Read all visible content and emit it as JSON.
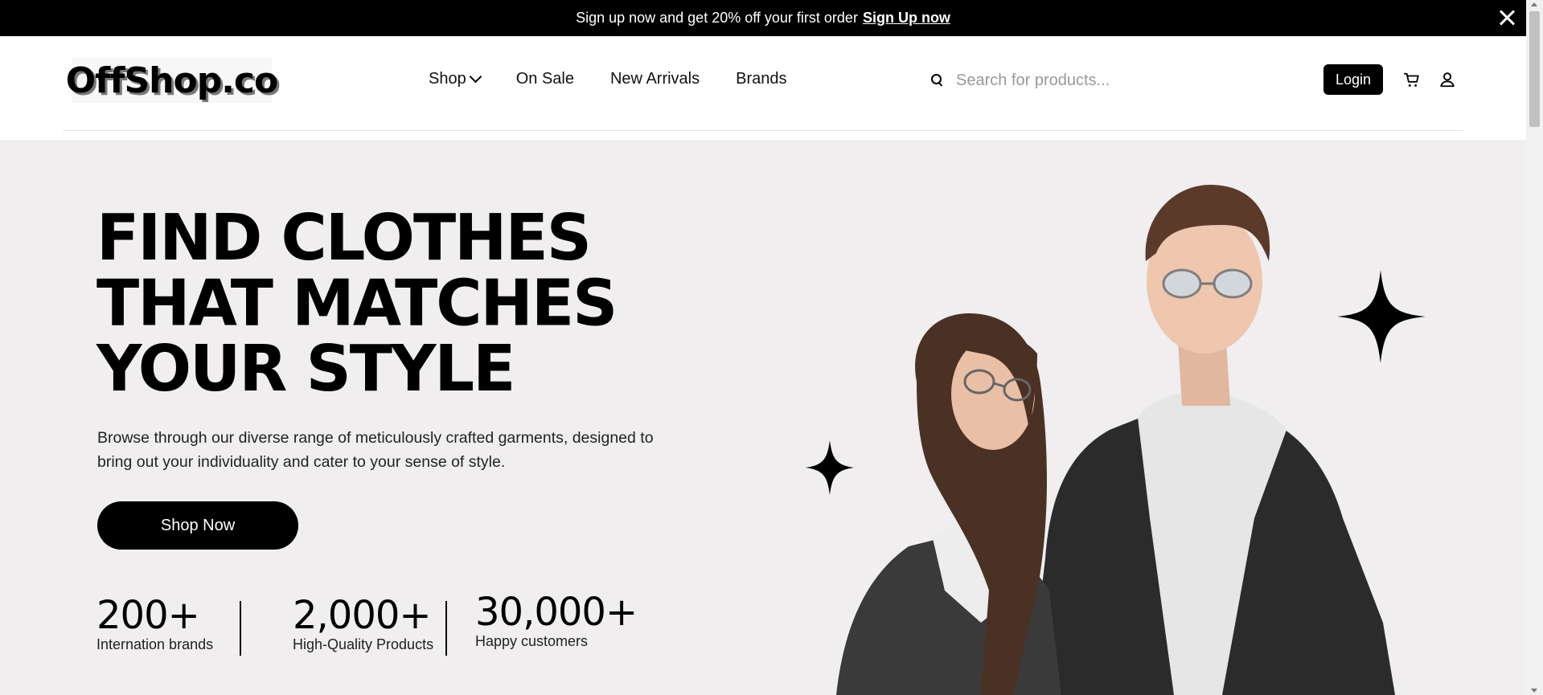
{
  "banner": {
    "text": "Sign up now and get 20% off your first order",
    "link": "Sign Up now"
  },
  "header": {
    "logo": "OffShop.co",
    "nav": [
      "Shop",
      "On Sale",
      "New Arrivals",
      "Brands"
    ],
    "search_placeholder": "Search for products...",
    "login_label": "Login"
  },
  "hero": {
    "title_lines": [
      "FIND CLOTHES",
      "THAT MATCHES",
      "YOUR STYLE"
    ],
    "description": "Browse through our diverse range of meticulously crafted garments, designed to bring out your individuality and cater to your sense of style.",
    "cta_label": "Shop Now",
    "stats": [
      {
        "value": "200+",
        "label": "Internation brands"
      },
      {
        "value": "2,000+",
        "label": "High-Quality Products"
      },
      {
        "value": "30,000+",
        "label": "Happy customers"
      }
    ]
  },
  "icons": [
    "close-icon",
    "chevron-down-icon",
    "search-icon",
    "cart-icon",
    "user-icon",
    "sparkle-star-icon"
  ],
  "colors": {
    "banner_bg": "#000000",
    "hero_bg": "#f0eeef",
    "button_bg": "#000000"
  }
}
